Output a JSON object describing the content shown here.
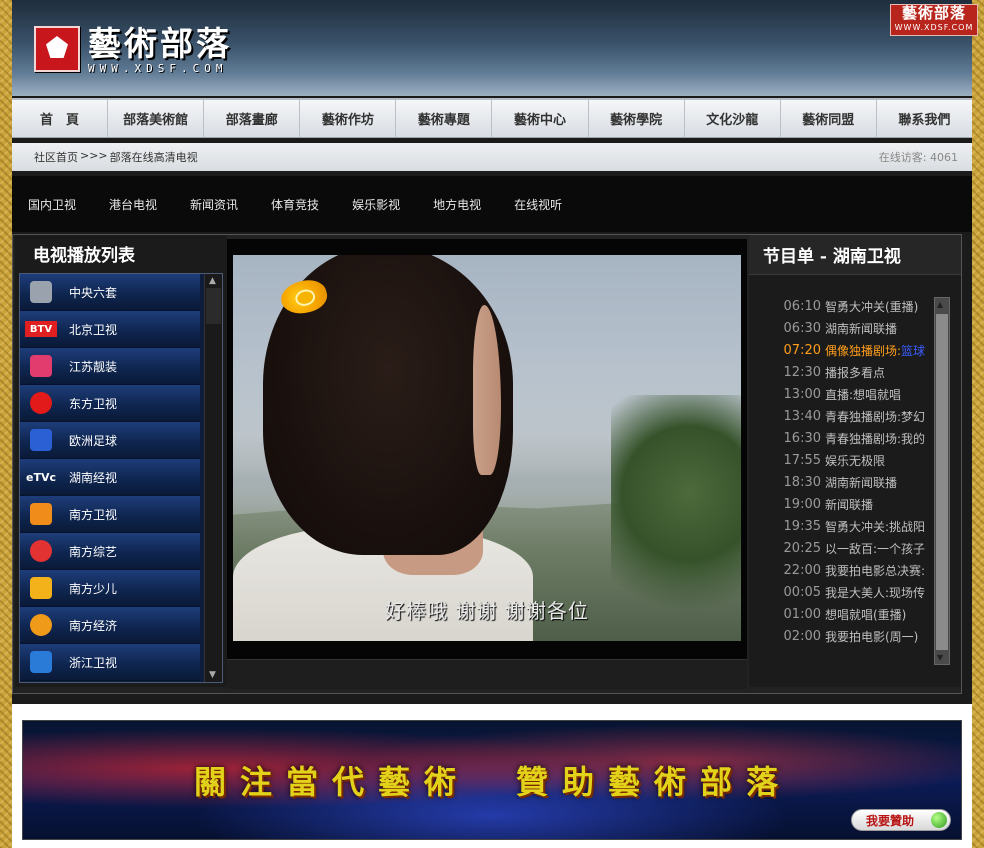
{
  "site": {
    "title": "藝術部落",
    "url_text": "WWW.XDSF.COM",
    "badge_title": "藝術部落",
    "badge_url": "WWW.XDSF.COM"
  },
  "nav": {
    "items": [
      "首　頁",
      "部落美術館",
      "部落畫廊",
      "藝術作坊",
      "藝術專題",
      "藝術中心",
      "藝術學院",
      "文化沙龍",
      "藝術同盟",
      "聯系我們"
    ]
  },
  "breadcrumb": {
    "home": "社区首页",
    "sep": ">>>",
    "current": "部落在线高清电视",
    "online_label": "在线访客:",
    "online_count": "4061"
  },
  "subnav": {
    "items": [
      "国内卫视",
      "港台电视",
      "新闻资讯",
      "体育竞技",
      "娱乐影视",
      "地方电视",
      "在线视听"
    ]
  },
  "channel_list": {
    "title": "电视播放列表",
    "channels": [
      {
        "name": "中央六套",
        "logo_text": "",
        "logo_color": "#9aa3ad"
      },
      {
        "name": "北京卫视",
        "logo_text": "BTV",
        "logo_color": "#e02020"
      },
      {
        "name": "江苏靓装",
        "logo_text": "",
        "logo_color": "#e23c6e"
      },
      {
        "name": "东方卫视",
        "logo_text": "",
        "logo_color": "#e21a1a"
      },
      {
        "name": "欧洲足球",
        "logo_text": "",
        "logo_color": "#2b5fd4"
      },
      {
        "name": "湖南经视",
        "logo_text": "eTVc",
        "logo_color": "#ffffff"
      },
      {
        "name": "南方卫视",
        "logo_text": "",
        "logo_color": "#f08c1a"
      },
      {
        "name": "南方综艺",
        "logo_text": "",
        "logo_color": "#e23232"
      },
      {
        "name": "南方少儿",
        "logo_text": "",
        "logo_color": "#f4b21a"
      },
      {
        "name": "南方经济",
        "logo_text": "",
        "logo_color": "#f09a1a"
      },
      {
        "name": "浙江卫视",
        "logo_text": "",
        "logo_color": "#2a7ad8"
      }
    ]
  },
  "video": {
    "subtitle": "好棒哦 谢谢 谢谢各位"
  },
  "program": {
    "title": "节目单 - 湖南卫视",
    "items": [
      {
        "time": "06:10",
        "name": "智勇大冲关(重播)",
        "extra": ""
      },
      {
        "time": "06:30",
        "name": "湖南新闻联播",
        "extra": ""
      },
      {
        "time": "07:20",
        "name": "偶像独播剧场:",
        "extra": "篮球",
        "current": true
      },
      {
        "time": "12:30",
        "name": "播报多看点",
        "extra": ""
      },
      {
        "time": "13:00",
        "name": "直播:想唱就唱",
        "extra": ""
      },
      {
        "time": "13:40",
        "name": "青春独播剧场:梦幻",
        "extra": ""
      },
      {
        "time": "16:30",
        "name": "青春独播剧场:我的",
        "extra": ""
      },
      {
        "time": "17:55",
        "name": "娱乐无极限",
        "extra": ""
      },
      {
        "time": "18:30",
        "name": "湖南新闻联播",
        "extra": ""
      },
      {
        "time": "19:00",
        "name": "新闻联播",
        "extra": ""
      },
      {
        "time": "19:35",
        "name": "智勇大冲关:挑战阳",
        "extra": ""
      },
      {
        "time": "20:25",
        "name": "以一敌百:一个孩子",
        "extra": ""
      },
      {
        "time": "22:00",
        "name": "我要拍电影总决赛:",
        "extra": ""
      },
      {
        "time": "00:05",
        "name": "我是大美人:现场传",
        "extra": ""
      },
      {
        "time": "01:00",
        "name": "想唱就唱(重播)",
        "extra": ""
      },
      {
        "time": "02:00",
        "name": "我要拍电影(周一)",
        "extra": ""
      }
    ]
  },
  "banner": {
    "text": "關注當代藝術　贊助藝術部落",
    "button": "我要贊助"
  }
}
